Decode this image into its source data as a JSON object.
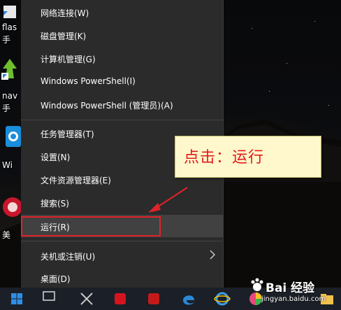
{
  "desktop": {
    "icons": [
      {
        "label": "flas",
        "sub": "手"
      },
      {
        "label": "nav",
        "sub": "手"
      },
      {
        "label": "Wi"
      },
      {
        "label": "美"
      }
    ]
  },
  "context_menu": {
    "items": [
      {
        "label": "网络连接(W)"
      },
      {
        "label": "磁盘管理(K)"
      },
      {
        "label": "计算机管理(G)"
      },
      {
        "label": "Windows PowerShell(I)"
      },
      {
        "label": "Windows PowerShell (管理员)(A)"
      },
      {
        "label": "任务管理器(T)"
      },
      {
        "label": "设置(N)"
      },
      {
        "label": "文件资源管理器(E)"
      },
      {
        "label": "搜索(S)"
      },
      {
        "label": "运行(R)",
        "highlighted": true
      },
      {
        "label": "关机或注销(U)",
        "has_submenu": true
      },
      {
        "label": "桌面(D)"
      }
    ]
  },
  "annotation": {
    "callout_text": "点击：运行",
    "highlight_color": "#e0232a",
    "text_color": "#e21a1a",
    "callout_bg": "#fff8cc"
  },
  "taskbar": {
    "icons": [
      "windows-start-icon",
      "task-view-icon",
      "tool-icon",
      "red-app-icon",
      "edge-icon",
      "ie-icon",
      "chrome-icon",
      "pinwheel-icon",
      "file-explorer-icon"
    ]
  },
  "watermark": {
    "brand": "Bai 经验",
    "url": "jingyan.baidu.com"
  }
}
